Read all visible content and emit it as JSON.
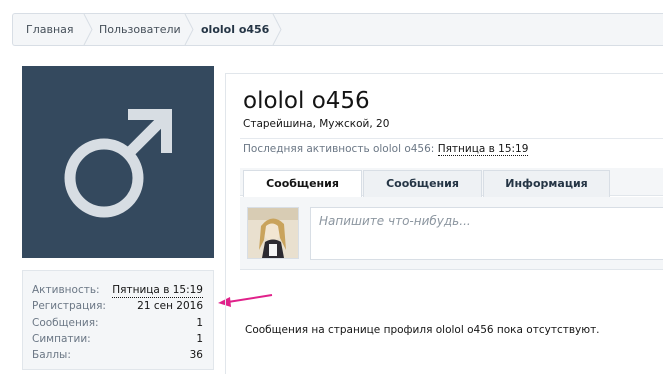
{
  "breadcrumb": {
    "items": [
      "Главная",
      "Пользователи"
    ],
    "current": "ololol o456"
  },
  "profile": {
    "username": "ololol o456",
    "user_title": "Старейшина, Мужской, 20",
    "last_activity_label": "Последняя активность ololol o456:",
    "last_activity_time": "Пятница в 15:19",
    "avatar_icon": "male-symbol-icon"
  },
  "tabs": [
    {
      "label": "Сообщения",
      "active": true
    },
    {
      "label": "Сообщения",
      "active": false
    },
    {
      "label": "Информация",
      "active": false
    }
  ],
  "composer": {
    "placeholder": "Напишите что-нибудь..."
  },
  "empty_message": "Сообщения на странице профиля ololol o456 пока отсутствуют.",
  "stats": [
    {
      "label": "Активность:",
      "value": "Пятница в 15:19"
    },
    {
      "label": "Регистрация:",
      "value": "21 сен 2016"
    },
    {
      "label": "Сообщения:",
      "value": "1"
    },
    {
      "label": "Симпатии:",
      "value": "1"
    },
    {
      "label": "Баллы:",
      "value": "36"
    }
  ],
  "colors": {
    "avatar_bg": "#34495e",
    "annotation_arrow": "#e0218a"
  }
}
